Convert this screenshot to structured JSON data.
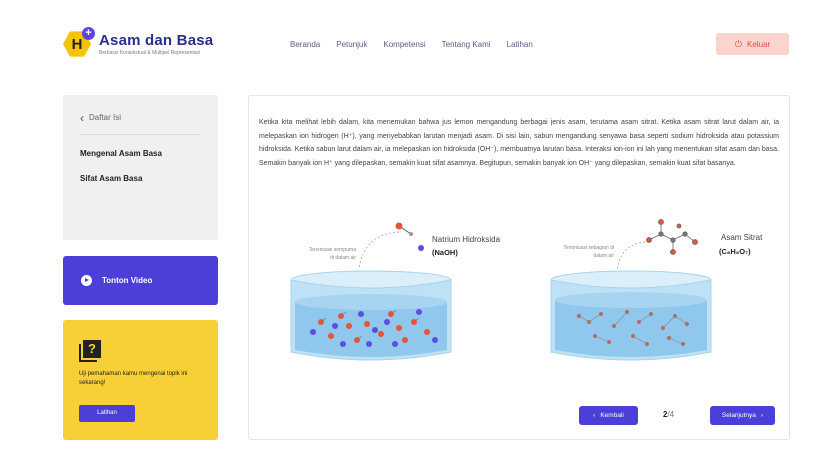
{
  "app": {
    "logo_letter": "H",
    "logo_plus": "+",
    "title": "Asam dan Basa",
    "subtitle": "Berbasis Kontekstual & Multipel Representasi"
  },
  "nav": {
    "items": [
      "Beranda",
      "Petunjuk",
      "Kompetensi",
      "Tentang Kami",
      "Latihan"
    ]
  },
  "logout": {
    "label": "Keluar"
  },
  "toc": {
    "back_label": "Daftar Isi",
    "items": [
      "Mengenal Asam Basa",
      "Sifat Asam Basa"
    ]
  },
  "video": {
    "label": "Tonton Video"
  },
  "quiz": {
    "text": "Uji pemahaman kamu mengenai topik ini sekarang!",
    "button": "Latihan"
  },
  "content": {
    "paragraph": "Ketika kita melihat lebih dalam, kita menemukan bahwa jus lemon mengandung berbagai jenis asam, terutama asam sitrat. Ketika asam sitrat larut dalam air, ia melepaskan ion hidrogen (H⁺), yang menyebabkan larutan menjadi asam. Di sisi lain, sabun mengandung senyawa basa seperti sodium hidroksida atau potassium hidroksida. Ketika sabun larut dalam air, ia melepaskan ion hidroksida (OH⁻), membuatnya larutan basa. Interaksi ion-ion ini lah yang menentukan sifat asam dan basa. Semakin banyak ion H⁺ yang dilepaskan, semakin kuat sifat asamnya. Begitupun, semakin banyak ion OH⁻ yang dilepaskan, semakin kuat sifat basanya."
  },
  "illustration": {
    "left_title": "Natrium Hidroksida",
    "left_formula": "(NaOH)",
    "left_note_1": "Terionisasi sempurna",
    "left_note_2": "di dalam air",
    "right_title": "Asam Sitrat",
    "right_formula": "(C₆H₈O₇)",
    "right_note_1": "Terionisasi sebagian di",
    "right_note_2": "dalam air"
  },
  "pagination": {
    "back_label": "Kembali",
    "current": "2",
    "total": "/4",
    "next_label": "Selanjutnya"
  },
  "colors": {
    "primary": "#4c3fd8",
    "accent_yellow": "#f7d038",
    "logout_bg": "#fbd5cd",
    "logout_text": "#e04b3a",
    "title_navy": "#2a2f8a",
    "water": "#8fc8ec"
  }
}
